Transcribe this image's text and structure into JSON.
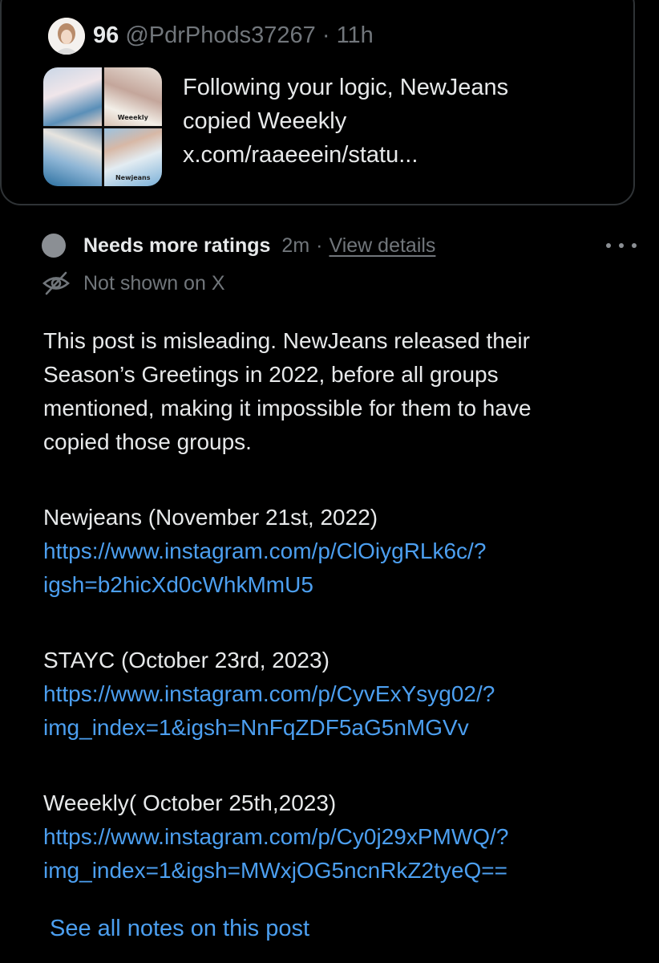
{
  "quoted_post": {
    "author_name": "96",
    "handle": "@PdrPhods37267",
    "separator": "·",
    "time": "11h",
    "thumbnail_caption_top": "Weeekly",
    "thumbnail_caption_bottom": "Newjeans",
    "text_lines": [
      "Following your logic, NewJeans",
      "copied Weeekly",
      "x.com/raaeeein/statu..."
    ]
  },
  "community_note": {
    "status_label": "Needs more ratings",
    "status_time": "2m",
    "separator": "·",
    "details_link": "View details",
    "visibility_label": "Not shown on X",
    "body": {
      "paragraph_lines": [
        "This post is misleading. NewJeans released their",
        "Season’s Greetings in 2022, before all groups",
        "mentioned, making it impossible for them to have",
        "copied those groups."
      ],
      "sources": [
        {
          "heading": "Newjeans (November 21st, 2022)",
          "link_lines": [
            "https://www.instagram.com/p/ClOiygRLk6c/?",
            "igsh=b2hicXd0cWhkMmU5"
          ]
        },
        {
          "heading": "STAYC (October 23rd, 2023)",
          "link_lines": [
            "https://www.instagram.com/p/CyvExYsyg02/?",
            "img_index=1&igsh=NnFqZDF5aG5nMGVv"
          ]
        },
        {
          "heading": "Weeekly( October 25th,2023)",
          "link_lines": [
            "https://www.instagram.com/p/Cy0j29xPMWQ/?",
            "img_index=1&igsh=MWxjOG5ncnRkZ2tyeQ=="
          ]
        }
      ]
    },
    "see_all_label": "See all notes on this post"
  },
  "colors": {
    "background": "#000000",
    "text_primary": "#e7e9ea",
    "text_secondary": "#71767b",
    "link": "#4c9ff0",
    "border": "#2f3336"
  },
  "icons": [
    "avatar-image",
    "post-thumbnail",
    "status-circle-icon",
    "more-icon",
    "eye-off-icon"
  ]
}
